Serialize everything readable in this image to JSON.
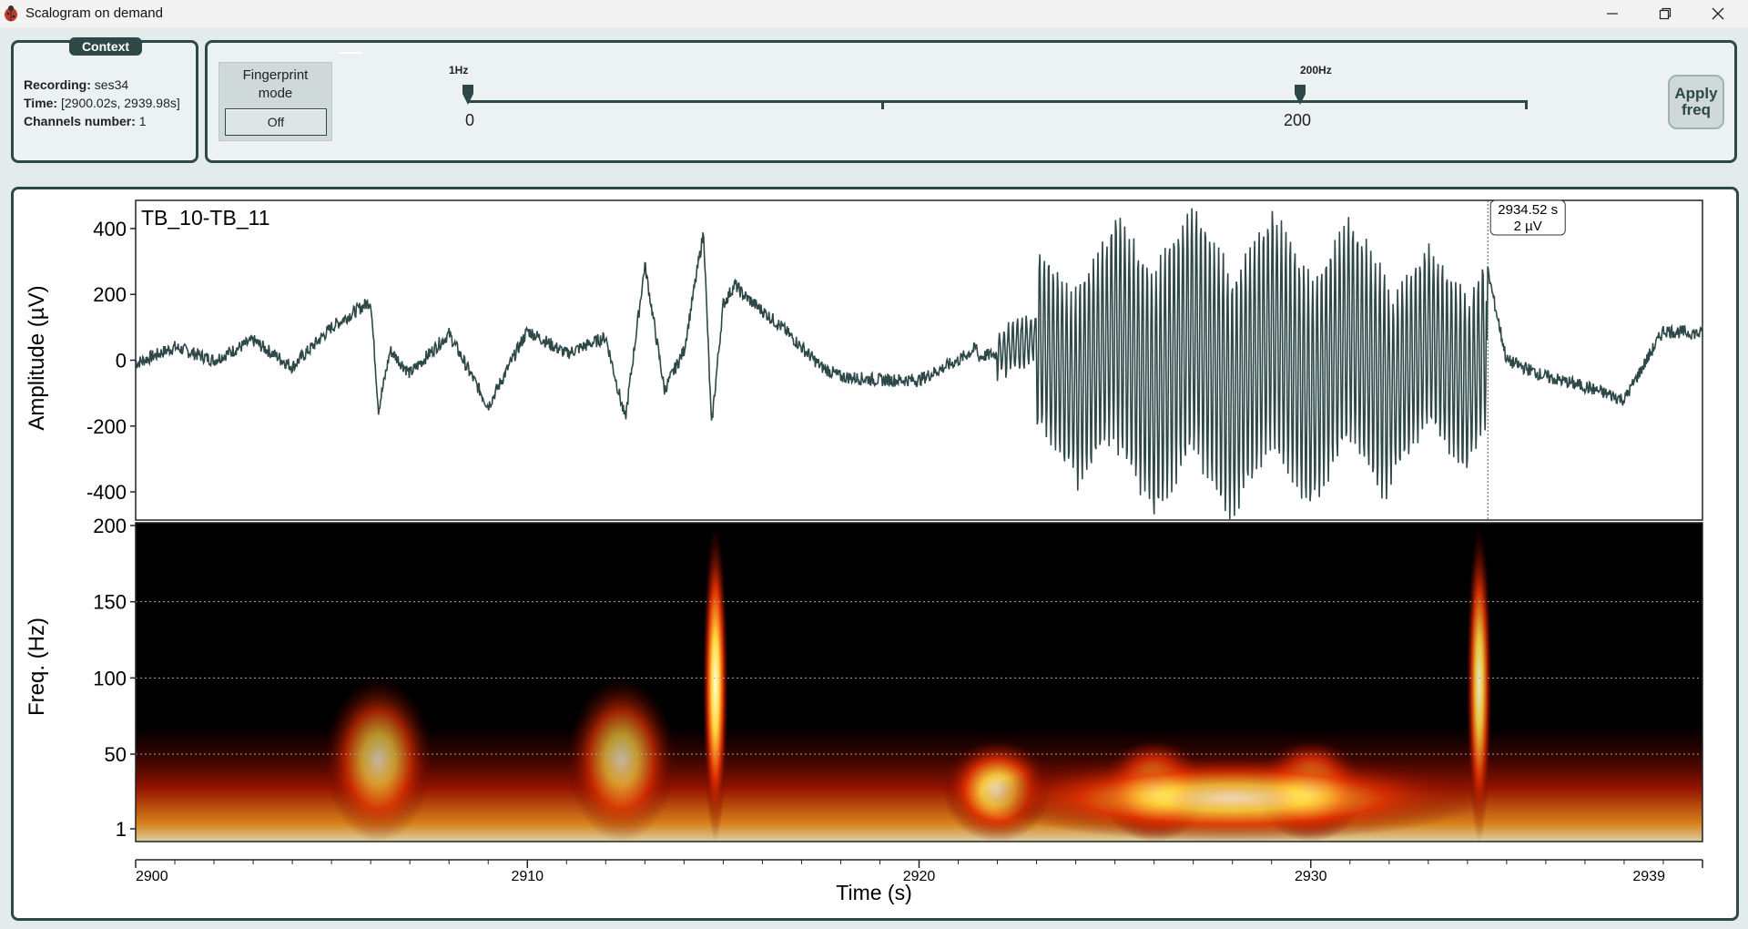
{
  "window": {
    "title": "Scalogram on demand",
    "icon": "beetle-icon"
  },
  "context": {
    "tag": "Context",
    "recording_label": "Recording:",
    "recording_value": "ses34",
    "time_label": "Time:",
    "time_value": "[2900.02s, 2939.98s]",
    "channels_label": "Channels number:",
    "channels_value": "1"
  },
  "fingerprint": {
    "label_line1": "Fingerprint",
    "label_line2": "mode",
    "toggle_value": "Off"
  },
  "freq_slider": {
    "min_caption": "1Hz",
    "max_caption": "200Hz",
    "low_value": "0",
    "high_value": "200",
    "range_min": 0,
    "range_max": 325,
    "selected_low": 1,
    "selected_high": 200
  },
  "apply_button": {
    "line1": "Apply",
    "line2": "freq"
  },
  "signal_plot": {
    "channel_label": "TB_10-TB_11",
    "ylabel": "Amplitude (µV)",
    "yticks": [
      "400",
      "200",
      "0",
      "-200",
      "-400"
    ],
    "cursor": {
      "time_label": "2934.52 s",
      "value_label": "2 µV",
      "time": 2934.52
    }
  },
  "scalogram_plot": {
    "ylabel": "Freq. (Hz)",
    "yticks": [
      "200",
      "150",
      "100",
      "50",
      "1"
    ]
  },
  "time_axis": {
    "xlabel": "Time (s)",
    "ticks": [
      "2900",
      "2910",
      "2920",
      "2930",
      "2939"
    ]
  },
  "colors": {
    "accent": "#2e4847",
    "background": "#e3ecea",
    "signal": "#2e4847"
  },
  "chart_data": [
    {
      "type": "line",
      "title": "TB_10-TB_11",
      "xlabel": "",
      "ylabel": "Amplitude (µV)",
      "xlim": [
        2900,
        2940
      ],
      "ylim": [
        -480,
        480
      ],
      "series": [
        {
          "name": "TB_10-TB_11",
          "x": [
            2900.0,
            2901.0,
            2902.0,
            2903.0,
            2904.0,
            2905.0,
            2906.0,
            2906.2,
            2906.5,
            2907.0,
            2908.0,
            2909.0,
            2910.0,
            2911.0,
            2912.0,
            2912.5,
            2913.0,
            2913.5,
            2914.0,
            2914.5,
            2914.7,
            2915.0,
            2915.3,
            2915.5,
            2916.0,
            2916.5,
            2917.0,
            2917.5,
            2918.0,
            2919.0,
            2920.0,
            2921.0,
            2922.0,
            2923.0,
            2924.0,
            2925.0,
            2926.0,
            2927.0,
            2928.0,
            2929.0,
            2930.0,
            2931.0,
            2932.0,
            2933.0,
            2934.0,
            2934.5,
            2935.0,
            2936.0,
            2937.0,
            2938.0,
            2939.0,
            2940.0
          ],
          "values": [
            -10,
            40,
            0,
            60,
            -20,
            100,
            180,
            -150,
            30,
            -40,
            80,
            -140,
            90,
            20,
            70,
            -180,
            290,
            -90,
            30,
            390,
            -200,
            170,
            230,
            200,
            150,
            100,
            40,
            -20,
            -50,
            -60,
            -60,
            0,
            80,
            300,
            -350,
            400,
            -420,
            420,
            -460,
            400,
            -420,
            380,
            -400,
            300,
            -330,
            280,
            0,
            -50,
            -80,
            -120,
            90,
            80
          ]
        }
      ]
    },
    {
      "type": "heatmap",
      "title": "",
      "xlabel": "Time (s)",
      "ylabel": "Freq. (Hz)",
      "xlim": [
        2900,
        2940
      ],
      "ylim": [
        1,
        200
      ],
      "bursts": [
        {
          "time": 2906.2,
          "freq_low": 1,
          "freq_high": 100,
          "intensity": 0.7
        },
        {
          "time": 2912.4,
          "freq_low": 1,
          "freq_high": 100,
          "intensity": 0.7
        },
        {
          "time": 2914.8,
          "freq_low": 1,
          "freq_high": 200,
          "intensity": 1.0
        },
        {
          "time": 2922.0,
          "freq_low": 1,
          "freq_high": 60,
          "intensity": 0.9
        },
        {
          "time": 2926.0,
          "freq_low": 1,
          "freq_high": 60,
          "intensity": 1.0
        },
        {
          "time": 2930.0,
          "freq_low": 1,
          "freq_high": 60,
          "intensity": 1.0
        },
        {
          "time": 2934.3,
          "freq_low": 1,
          "freq_high": 200,
          "intensity": 0.9
        }
      ]
    }
  ]
}
